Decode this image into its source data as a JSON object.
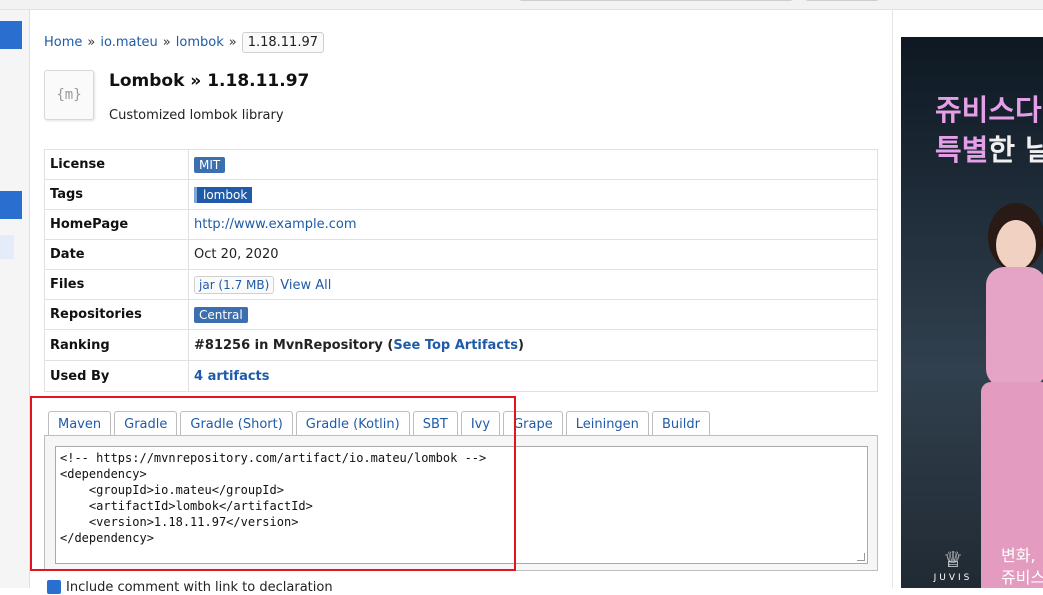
{
  "breadcrumb": {
    "items": [
      "Home",
      "io.mateu",
      "lombok"
    ],
    "separator": "»",
    "current": "1.18.11.97"
  },
  "header": {
    "logo_text": "{m}",
    "title": "Lombok » 1.18.11.97",
    "subtitle": "Customized lombok library"
  },
  "info": {
    "license": {
      "key": "License",
      "value": "MIT"
    },
    "tags": {
      "key": "Tags",
      "value": "lombok"
    },
    "homepage": {
      "key": "HomePage",
      "value": "http://www.example.com"
    },
    "date": {
      "key": "Date",
      "value": "Oct 20, 2020"
    },
    "files": {
      "key": "Files",
      "jar": "jar (1.7 MB)",
      "view_all": "View All"
    },
    "repositories": {
      "key": "Repositories",
      "value": "Central"
    },
    "ranking": {
      "key": "Ranking",
      "prefix": "#81256 in MvnRepository (",
      "link": "See Top Artifacts",
      "suffix": ")"
    },
    "used_by": {
      "key": "Used By",
      "value": "4 artifacts"
    }
  },
  "tabs": [
    "Maven",
    "Gradle",
    "Gradle (Short)",
    "Gradle (Kotlin)",
    "SBT",
    "Ivy",
    "Grape",
    "Leiningen",
    "Buildr"
  ],
  "active_tab": "Maven",
  "snippet": "<!-- https://mvnrepository.com/artifact/io.mateu/lombok -->\n<dependency>\n    <groupId>io.mateu</groupId>\n    <artifactId>lombok</artifactId>\n    <version>1.18.11.97</version>\n</dependency>",
  "include_comment_label": "Include comment with link to declaration",
  "ad": {
    "line1": "쥬비스다",
    "line2_pink": "특별",
    "line2_rest": "한 날",
    "bottom1": "변화,",
    "bottom2": "쥬비스",
    "logo": "JUVIS"
  },
  "colors": {
    "link": "#1f5ba8",
    "highlight_box": "#e0161e",
    "license_badge": "#3b6fb0",
    "ad_pink": "#e59fe8"
  }
}
